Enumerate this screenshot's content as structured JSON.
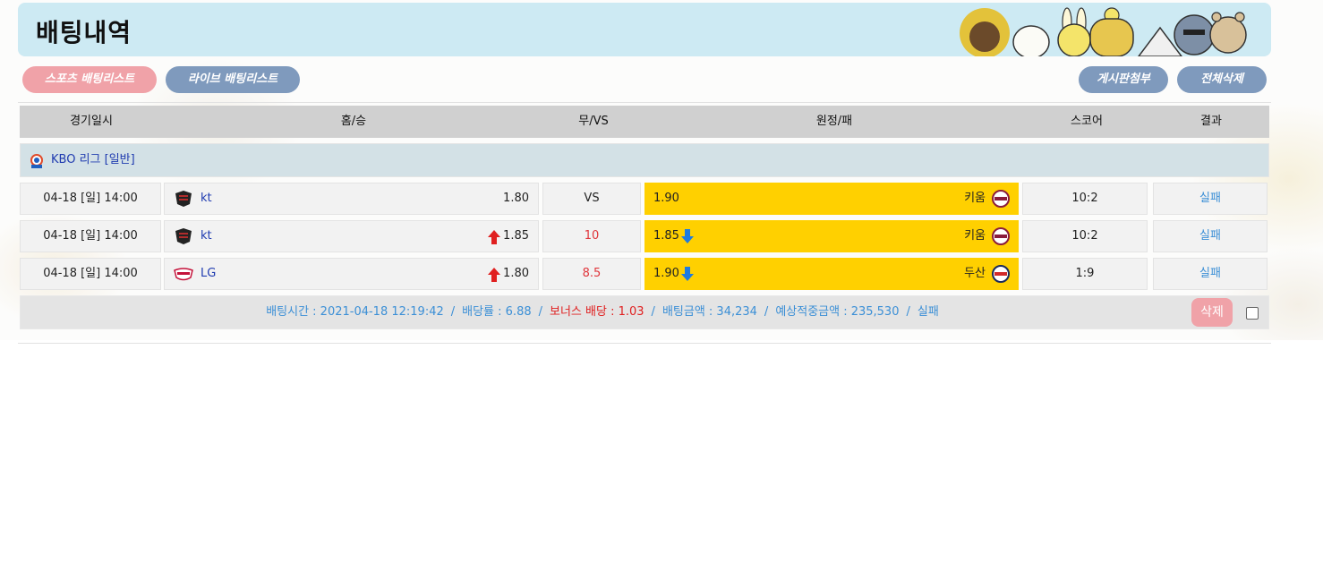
{
  "page": {
    "title": "배팅내역"
  },
  "tabs": {
    "sports": "스포츠 배팅리스트",
    "live": "라이브 배팅리스트",
    "board_attach": "게시판첨부",
    "delete_all": "전체삭제"
  },
  "table": {
    "headers": {
      "date": "경기일시",
      "home": "홈/승",
      "draw": "무/VS",
      "away": "원정/패",
      "score": "스코어",
      "result": "결과"
    },
    "league": {
      "name": "KBO 리그 [일반]",
      "icon": "kbo-logo-icon"
    },
    "rows": [
      {
        "date": "04-18 [일] 14:00",
        "home_team": "kt",
        "home_logo": "kt-wiz-logo-icon",
        "home_odds": "1.80",
        "home_arrow": "",
        "draw": "VS",
        "away_odds": "1.90",
        "away_arrow": "",
        "away_team": "키움",
        "away_logo": "kiwoom-logo-icon",
        "score": "10:2",
        "result": "실패"
      },
      {
        "date": "04-18 [일] 14:00",
        "home_team": "kt",
        "home_logo": "kt-wiz-logo-icon",
        "home_odds": "1.85",
        "home_arrow": "up",
        "draw": "10",
        "away_odds": "1.85",
        "away_arrow": "down",
        "away_team": "키움",
        "away_logo": "kiwoom-logo-icon",
        "score": "10:2",
        "result": "실패"
      },
      {
        "date": "04-18 [일] 14:00",
        "home_team": "LG",
        "home_logo": "lg-twins-logo-icon",
        "home_odds": "1.80",
        "home_arrow": "up",
        "draw": "8.5",
        "away_odds": "1.90",
        "away_arrow": "down",
        "away_team": "두산",
        "away_logo": "doosan-logo-icon",
        "score": "1:9",
        "result": "실패"
      }
    ]
  },
  "summary": {
    "bet_time": "배팅시간 : 2021-04-18 12:19:42",
    "odds": "배당률 : 6.88",
    "bonus": "보너스 배당 : 1.03",
    "amount": "배팅금액 : 34,234",
    "expected": "예상적중금액 : 235,530",
    "status": "실패",
    "separator": "/",
    "delete_label": "삭제"
  },
  "colors": {
    "header_bg": "#cdeaf3",
    "pill_pink": "#f0a2a8",
    "pill_blue": "#7f9abd",
    "away_highlight": "#ffd000",
    "link_blue": "#3b8fd6",
    "up_red": "#e0353b",
    "down_blue": "#1e7be0"
  }
}
